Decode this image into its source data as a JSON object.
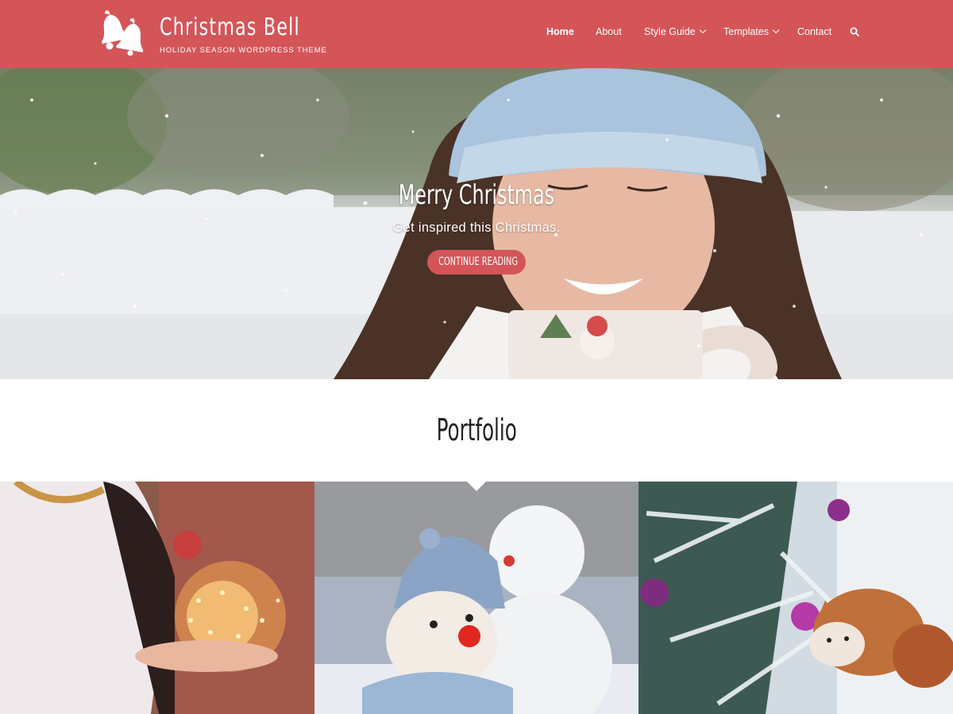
{
  "header": {
    "site_title": "Christmas Bell",
    "tagline": "HOLIDAY SEASON WORDPRESS THEME",
    "background_color": "#d45558",
    "logo_icon": "bells-icon",
    "nav": [
      {
        "label": "Home",
        "active": true,
        "dropdown": false
      },
      {
        "label": "About",
        "active": false,
        "dropdown": false
      },
      {
        "label": "Style Guide",
        "active": false,
        "dropdown": true
      },
      {
        "label": "Templates",
        "active": false,
        "dropdown": true
      },
      {
        "label": "Contact",
        "active": false,
        "dropdown": false
      }
    ],
    "search_icon": "search-icon"
  },
  "hero": {
    "title": "Merry Christmas",
    "subtitle": "Get inspired this Christmas.",
    "button_label": "CONTINUE READING",
    "button_color": "#d45558"
  },
  "portfolio": {
    "title": "Portfolio",
    "tiles": [
      {
        "image": "woman-holding-fairy-lights"
      },
      {
        "image": "knitted-snowman-and-snowman"
      },
      {
        "image": "cat-under-christmas-tree"
      }
    ]
  }
}
